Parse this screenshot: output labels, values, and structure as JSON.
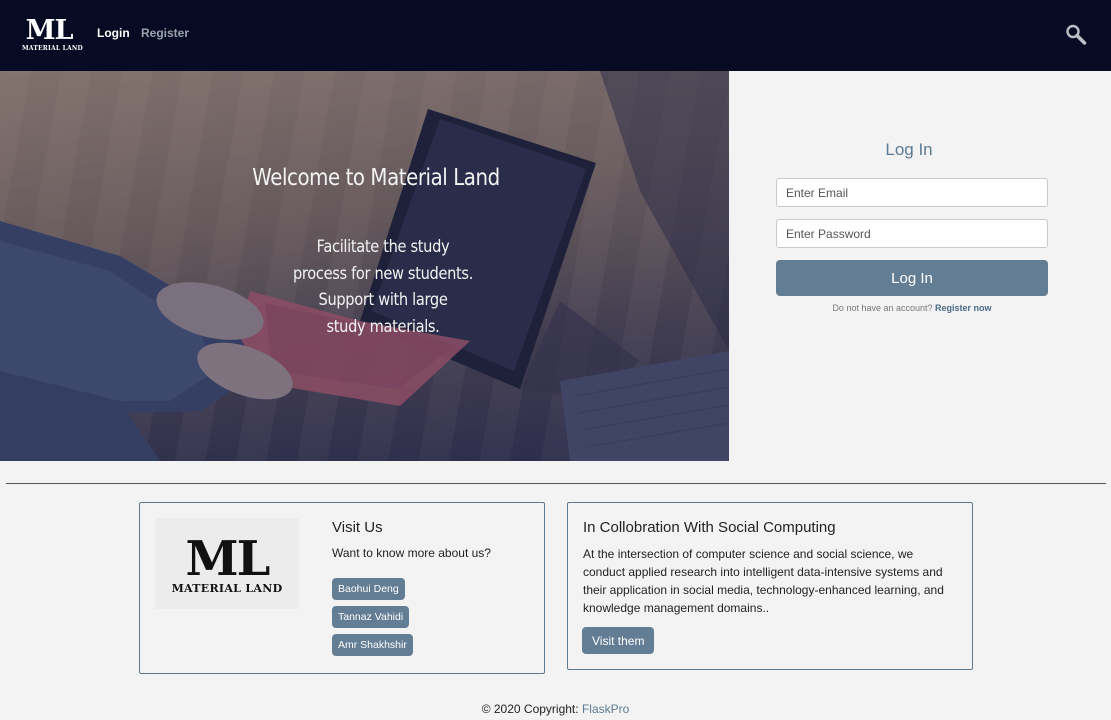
{
  "navbar": {
    "logo_big": "ML",
    "logo_small": "MATERIAL LAND",
    "login": "Login",
    "register": "Register"
  },
  "hero": {
    "title": "Welcome to Material Land",
    "subtitle_lines": [
      "Facilitate the study",
      "process for new students.",
      "Support with large",
      "study materials."
    ]
  },
  "login": {
    "title": "Log In",
    "email_placeholder": "Enter Email",
    "password_placeholder": "Enter Password",
    "button": "Log In",
    "no_account": "Do not have an account?",
    "register_now": "Register now"
  },
  "visit": {
    "logo_big": "ML",
    "logo_small": "MATERIAL LAND",
    "title": "Visit Us",
    "text": "Want to know more about us?",
    "people": [
      "Baohui Deng",
      "Tannaz Vahidi",
      "Amr Shakhshir"
    ]
  },
  "collab": {
    "title": "In Collobration With Social Computing",
    "text": "At the intersection of computer science and social science, we conduct applied research into intelligent data-intensive systems and their application in social media, technology-enhanced learning, and knowledge management domains..",
    "button": "Visit them"
  },
  "footer": {
    "copyright": "© 2020 Copyright:",
    "link": "FlaskPro"
  },
  "colors": {
    "navbar_bg": "#060a22",
    "accent": "#637d94",
    "page_bg": "#f3f3f3"
  },
  "icons": {
    "search": "search-icon"
  }
}
